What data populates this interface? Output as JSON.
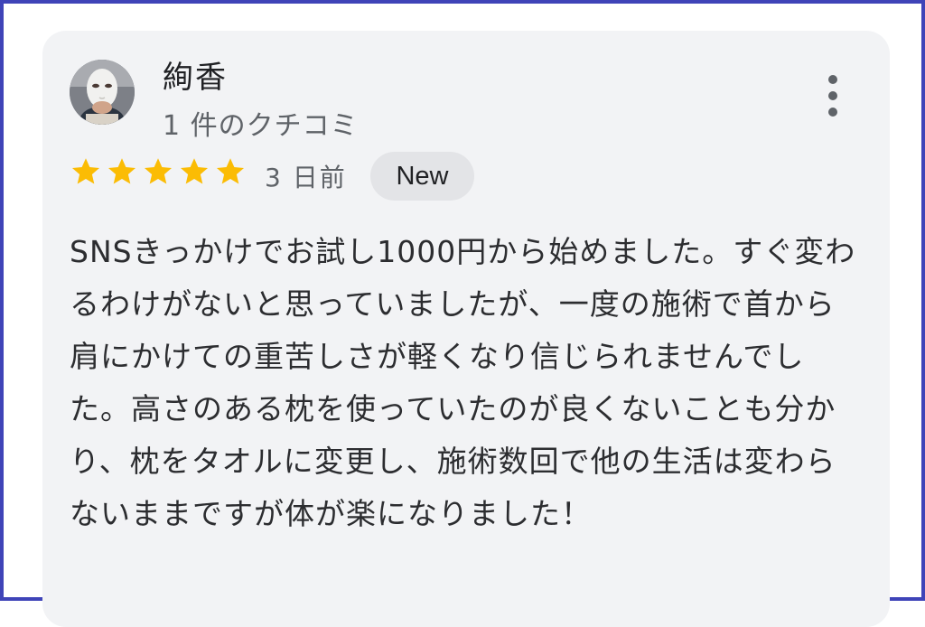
{
  "review": {
    "reviewer_name": "絢香",
    "review_count": "1 件のクチコミ",
    "rating": 5,
    "rating_max": 5,
    "date": "3 日前",
    "badge": "New",
    "text": "SNSきっかけでお試し1000円から始めました。すぐ変わるわけがないと思っていましたが、一度の施術で首から肩にかけての重苦しさが軽くなり信じられませんでした。高さのある枕を使っていたのが良くないことも分かり、枕をタオルに変更し、施術数回で他の生活は変わらないままですが体が楽になりました！"
  },
  "icons": {
    "avatar": "masked-person-avatar",
    "more": "more-vert-icon",
    "star": "star-icon"
  },
  "colors": {
    "frame_border": "#3f44b8",
    "card_background": "#f2f3f5",
    "star": "#fbbc04",
    "badge_background": "#e3e4e7",
    "primary_text": "#202124",
    "secondary_text": "#5f6368"
  }
}
